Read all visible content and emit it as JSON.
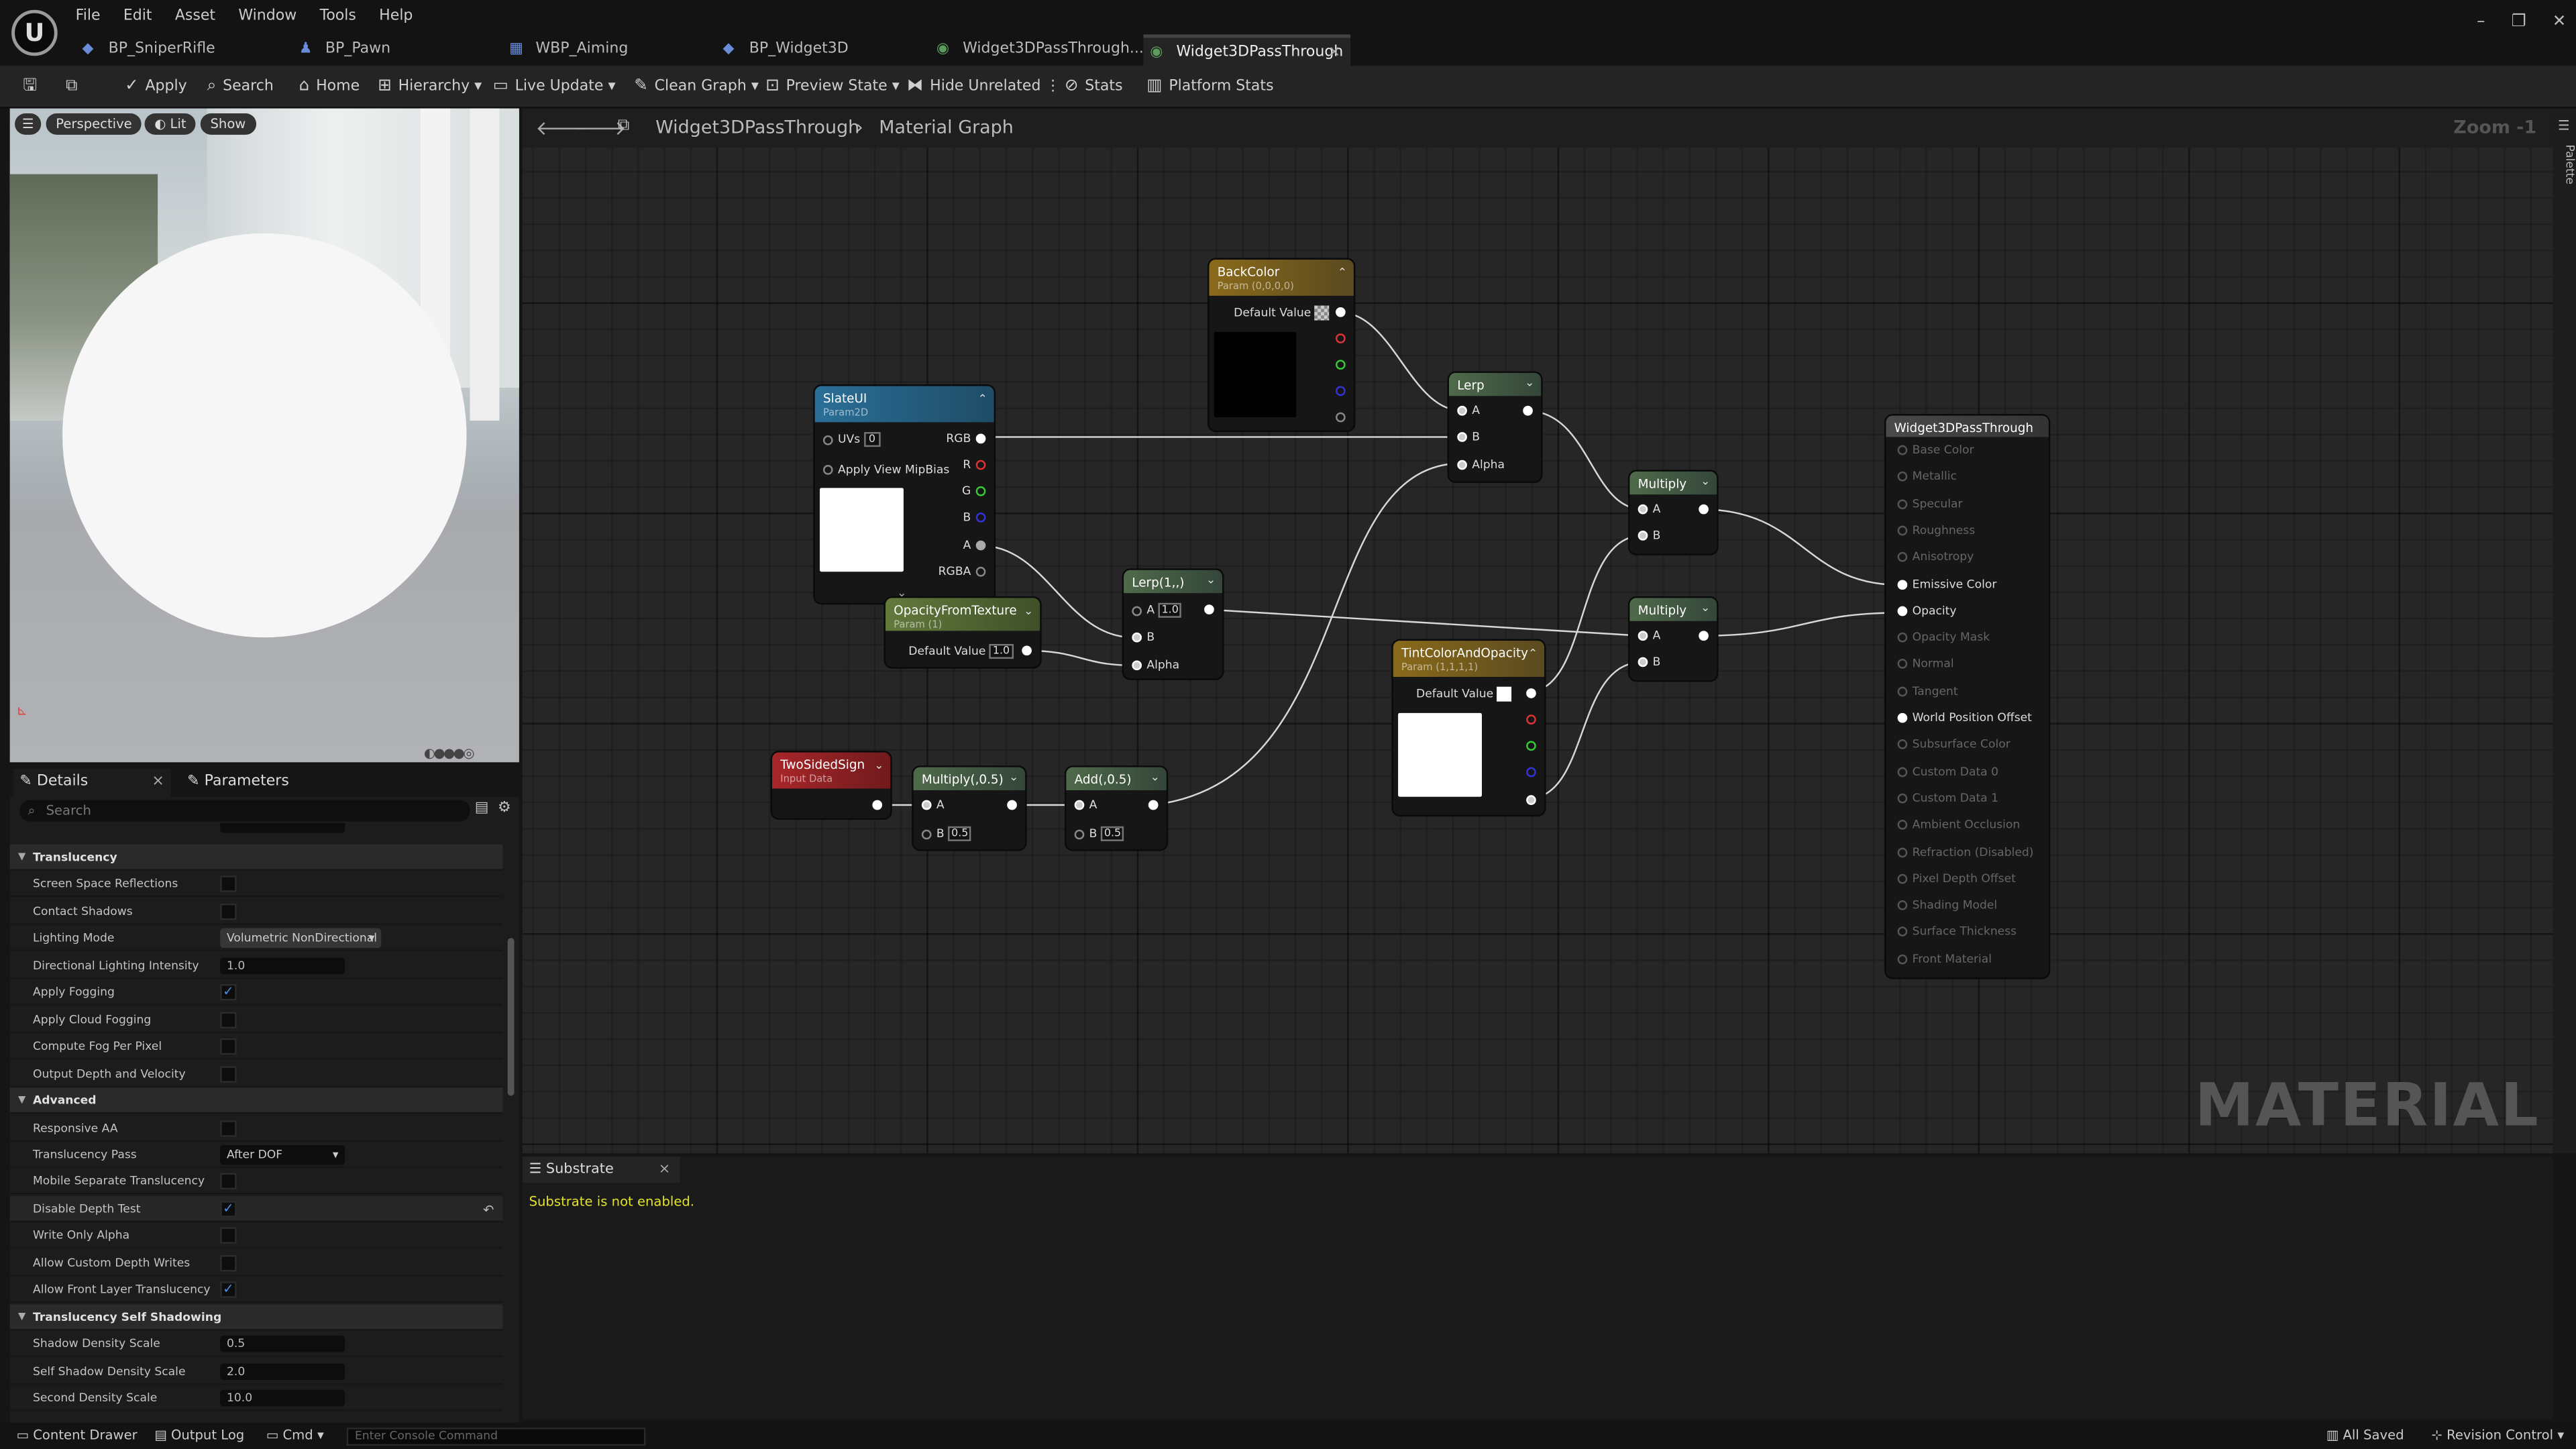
{
  "menu": [
    "File",
    "Edit",
    "Asset",
    "Window",
    "Tools",
    "Help"
  ],
  "tabs": [
    {
      "label": "BP_SniperRifle",
      "icon": "blueprint-icon"
    },
    {
      "label": "BP_Pawn",
      "icon": "pawn-icon"
    },
    {
      "label": "WBP_Aiming",
      "icon": "widget-blueprint-icon"
    },
    {
      "label": "BP_Widget3D",
      "icon": "blueprint-icon"
    },
    {
      "label": "Widget3DPassThrough...",
      "icon": "material-icon"
    },
    {
      "label": "Widget3DPassThrough",
      "icon": "material-icon"
    }
  ],
  "toolbar": {
    "apply": "Apply",
    "search": "Search",
    "home": "Home",
    "hierarchy": "Hierarchy",
    "live_update": "Live Update",
    "clean_graph": "Clean Graph",
    "preview_state": "Preview State",
    "hide_unrelated": "Hide Unrelated",
    "stats": "Stats",
    "platform_stats": "Platform Stats"
  },
  "viewport": {
    "perspective": "Perspective",
    "lit": "Lit",
    "show": "Show"
  },
  "details": {
    "tab_details": "Details",
    "tab_parameters": "Parameters",
    "search_placeholder": "Search",
    "rows": [
      {
        "type": "sec",
        "label": "Translucency"
      },
      {
        "type": "check",
        "label": "Screen Space Reflections",
        "checked": false
      },
      {
        "type": "check",
        "label": "Contact Shadows",
        "checked": false
      },
      {
        "type": "dd",
        "label": "Lighting Mode",
        "value": "Volumetric NonDirectional"
      },
      {
        "type": "num",
        "label": "Directional Lighting Intensity",
        "value": "1.0"
      },
      {
        "type": "check",
        "label": "Apply Fogging",
        "checked": true
      },
      {
        "type": "check",
        "label": "Apply Cloud Fogging",
        "checked": false
      },
      {
        "type": "check",
        "label": "Compute Fog Per Pixel",
        "checked": false
      },
      {
        "type": "check",
        "label": "Output Depth and Velocity",
        "checked": false
      },
      {
        "type": "sec",
        "label": "Advanced"
      },
      {
        "type": "check",
        "label": "Responsive AA",
        "checked": false
      },
      {
        "type": "dd2",
        "label": "Translucency Pass",
        "value": "After DOF"
      },
      {
        "type": "check",
        "label": "Mobile Separate Translucency",
        "checked": false
      },
      {
        "type": "check",
        "label": "Disable Depth Test",
        "checked": true,
        "highlight": true
      },
      {
        "type": "check",
        "label": "Write Only Alpha",
        "checked": false
      },
      {
        "type": "check",
        "label": "Allow Custom Depth Writes",
        "checked": false
      },
      {
        "type": "check",
        "label": "Allow Front Layer Translucency",
        "checked": true
      },
      {
        "type": "sec",
        "label": "Translucency Self Shadowing"
      },
      {
        "type": "num",
        "label": "Shadow Density Scale",
        "value": "0.5"
      },
      {
        "type": "num",
        "label": "Self Shadow Density Scale",
        "value": "2.0"
      },
      {
        "type": "num",
        "label": "Second Density Scale",
        "value": "10.0"
      }
    ]
  },
  "graph": {
    "breadcrumb_root": "Widget3DPassThrough",
    "breadcrumb_leaf": "Material Graph",
    "zoom": "Zoom -1",
    "palette": "Palette",
    "watermark": "MATERIAL"
  },
  "nodes": {
    "backcolor": {
      "title": "BackColor",
      "sub": "Param (0,0,0,0)",
      "default": "Default Value"
    },
    "slateui": {
      "title": "SlateUI",
      "sub": "Param2D",
      "uvs": "UVs",
      "uvs_val": "0",
      "mip": "Apply View MipBias",
      "rgb": "RGB",
      "r": "R",
      "g": "G",
      "b": "B",
      "a": "A",
      "rgba": "RGBA"
    },
    "opacity": {
      "title": "OpacityFromTexture",
      "sub": "Param (1)",
      "default": "Default Value",
      "val": "1.0"
    },
    "lerp1": {
      "title": "Lerp(1,,)",
      "a": "A",
      "a_val": "1.0",
      "b": "B",
      "alpha": "Alpha"
    },
    "lerp": {
      "title": "Lerp",
      "a": "A",
      "b": "B",
      "alpha": "Alpha"
    },
    "multiply1": {
      "title": "Multiply",
      "a": "A",
      "b": "B"
    },
    "multiply2": {
      "title": "Multiply",
      "a": "A",
      "b": "B"
    },
    "tint": {
      "title": "TintColorAndOpacity",
      "sub": "Param (1,1,1,1)",
      "default": "Default Value"
    },
    "twosided": {
      "title": "TwoSidedSign",
      "sub": "Input Data"
    },
    "mul05": {
      "title": "Multiply(,0.5)",
      "a": "A",
      "b": "B",
      "b_val": "0.5"
    },
    "add05": {
      "title": "Add(,0.5)",
      "a": "A",
      "b": "B",
      "b_val": "0.5"
    },
    "result": {
      "title": "Widget3DPassThrough",
      "pins": [
        {
          "label": "Base Color",
          "active": false
        },
        {
          "label": "Metallic",
          "active": false
        },
        {
          "label": "Specular",
          "active": false
        },
        {
          "label": "Roughness",
          "active": false
        },
        {
          "label": "Anisotropy",
          "active": false
        },
        {
          "label": "Emissive Color",
          "active": true
        },
        {
          "label": "Opacity",
          "active": true
        },
        {
          "label": "Opacity Mask",
          "active": false
        },
        {
          "label": "Normal",
          "active": false
        },
        {
          "label": "Tangent",
          "active": false
        },
        {
          "label": "World Position Offset",
          "active": true
        },
        {
          "label": "Subsurface Color",
          "active": false
        },
        {
          "label": "Custom Data 0",
          "active": false
        },
        {
          "label": "Custom Data 1",
          "active": false
        },
        {
          "label": "Ambient Occlusion",
          "active": false
        },
        {
          "label": "Refraction (Disabled)",
          "active": false
        },
        {
          "label": "Pixel Depth Offset",
          "active": false
        },
        {
          "label": "Shading Model",
          "active": false
        },
        {
          "label": "Surface Thickness",
          "active": false
        },
        {
          "label": "Front Material",
          "active": false
        }
      ]
    }
  },
  "substrate": {
    "tab": "Substrate",
    "message": "Substrate is not enabled."
  },
  "statusbar": {
    "content_drawer": "Content Drawer",
    "output_log": "Output Log",
    "cmd": "Cmd",
    "console_placeholder": "Enter Console Command",
    "all_saved": "All Saved",
    "revision_control": "Revision Control"
  }
}
